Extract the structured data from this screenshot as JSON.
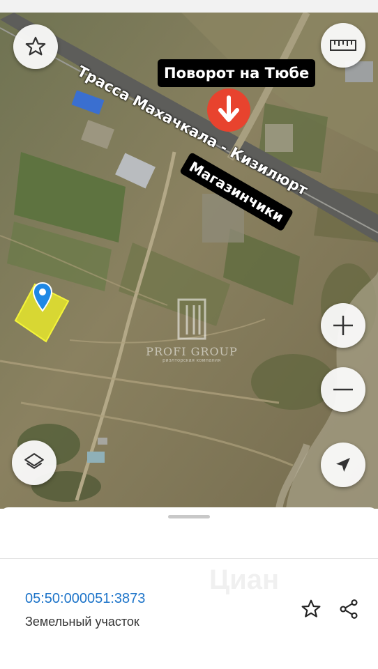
{
  "map": {
    "labels": {
      "turn": "Поворот на Тюбе",
      "highway": "Трасса Махачкала - Кизилюрт",
      "shops": "Магазинчики"
    },
    "watermark": {
      "title": "PROFI GROUP",
      "subtitle": "риэлторская компания"
    },
    "controls": [
      "favorite-star",
      "ruler",
      "zoom-in",
      "zoom-out",
      "layers",
      "my-location"
    ],
    "colors": {
      "turn_marker": "#e8432e",
      "parcel_fill": "#e6e62c",
      "pin": "#1e88e5"
    }
  },
  "sheet": {
    "cadastral_number": "05:50:000051:3873",
    "land_type": "Земельный участок",
    "watermark": "Циан"
  }
}
